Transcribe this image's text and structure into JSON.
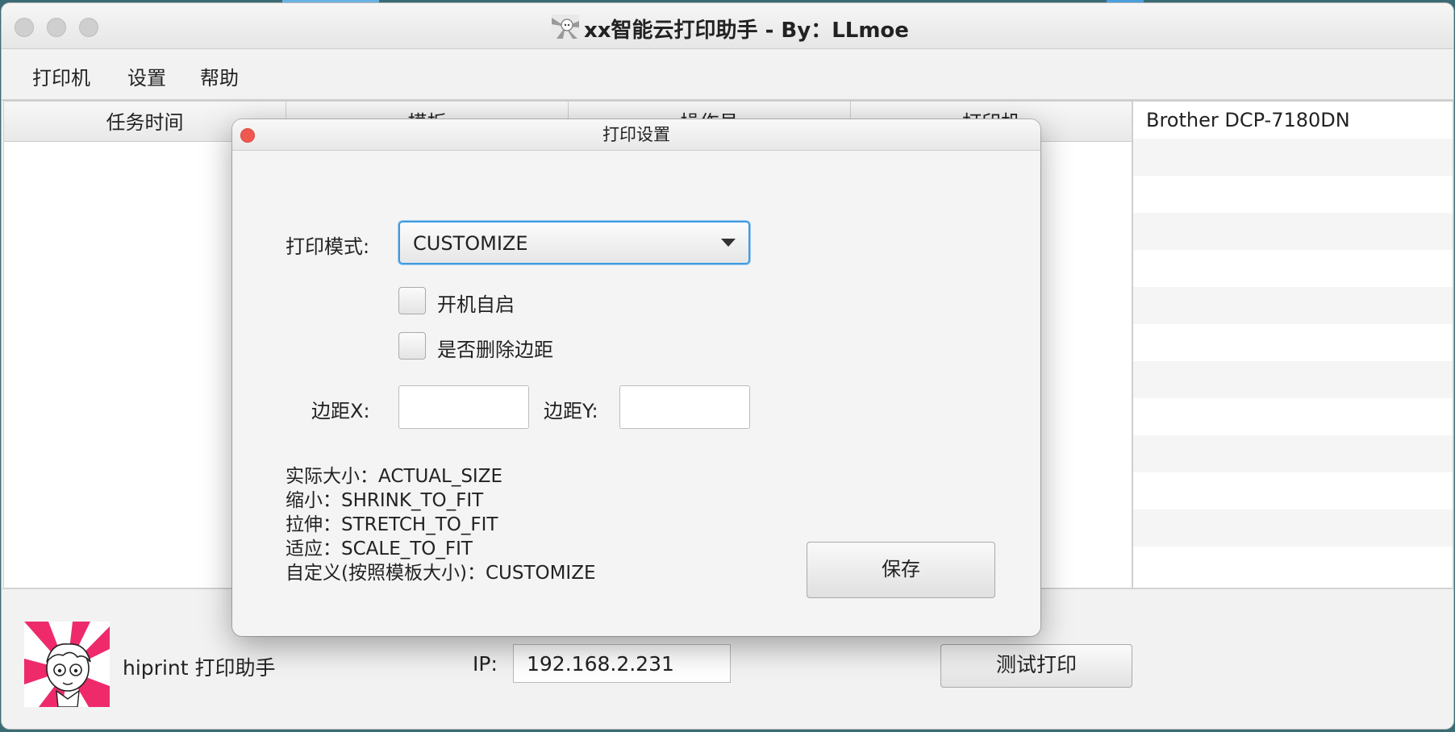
{
  "window": {
    "title": "xx智能云打印助手 - By：LLmoe"
  },
  "menubar": {
    "items": [
      "打印机",
      "设置",
      "帮助"
    ]
  },
  "table": {
    "columns": [
      "任务时间",
      "模板",
      "操作员",
      "打印机"
    ]
  },
  "printers": {
    "items": [
      "Brother DCP-7180DN"
    ]
  },
  "bottom": {
    "app_name": "hiprint 打印助手",
    "ip_label": "IP:",
    "ip_value": "192.168.2.231",
    "test_print_label": "测试打印"
  },
  "dialog": {
    "title": "打印设置",
    "mode_label": "打印模式:",
    "mode_value": "CUSTOMIZE",
    "autostart_label": "开机自启",
    "autostart_checked": false,
    "remove_margin_label": "是否删除边距",
    "remove_margin_checked": false,
    "margin_x_label": "边距X:",
    "margin_x_value": "",
    "margin_y_label": "边距Y:",
    "margin_y_value": "",
    "legend": [
      "实际大小：ACTUAL_SIZE",
      "缩小：SHRINK_TO_FIT",
      "拉伸：STRETCH_TO_FIT",
      "适应：SCALE_TO_FIT",
      "自定义(按照模板大小)：CUSTOMIZE"
    ],
    "save_label": "保存"
  },
  "colors": {
    "focus_ring": "#3d9be0",
    "close_button": "#f0574f",
    "avatar_accent": "#ee2a6b"
  }
}
